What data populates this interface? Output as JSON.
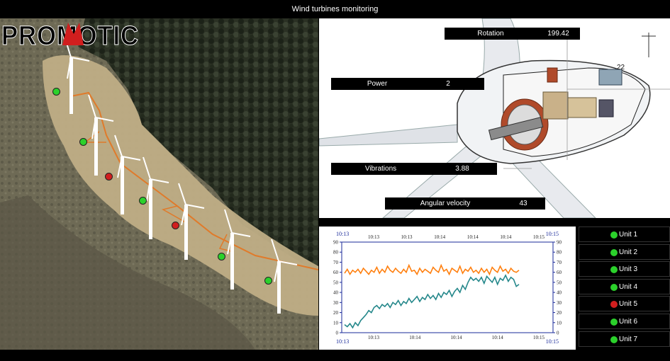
{
  "app": {
    "title": "Wind turbines monitoring"
  },
  "logo": {
    "text": "PROMOTIC"
  },
  "readouts": {
    "rotation": {
      "label": "Rotation",
      "value": "199.42"
    },
    "power": {
      "label": "Power",
      "value": "2"
    },
    "vibrations": {
      "label": "Vibrations",
      "value": "3.88"
    },
    "angular_velocity": {
      "label": "Angular velocity",
      "value": "43"
    },
    "wind_label": "22"
  },
  "colors": {
    "ok": "#2bd12b",
    "fault": "#d11e1e",
    "orange": "#ff7f0e",
    "teal": "#24878a",
    "axis": "#1a2a9a"
  },
  "map_markers": [
    {
      "status": "ok"
    },
    {
      "status": "ok"
    },
    {
      "status": "fault"
    },
    {
      "status": "ok"
    },
    {
      "status": "fault"
    },
    {
      "status": "ok"
    },
    {
      "status": "ok"
    }
  ],
  "units": [
    {
      "name": "Unit 1",
      "status": "ok"
    },
    {
      "name": "Unit 2",
      "status": "ok"
    },
    {
      "name": "Unit 3",
      "status": "ok"
    },
    {
      "name": "Unit 4",
      "status": "ok"
    },
    {
      "name": "Unit 5",
      "status": "fault"
    },
    {
      "name": "Unit 6",
      "status": "ok"
    },
    {
      "name": "Unit 7",
      "status": "ok"
    }
  ],
  "chart_data": {
    "type": "line",
    "ylim": [
      0,
      90
    ],
    "y_ticks": [
      "0",
      "10",
      "20",
      "30",
      "40",
      "50",
      "60",
      "70",
      "80",
      "90"
    ],
    "top_left_time": "10:13",
    "top_right_time": "10:15",
    "bottom_left_time": "10:13",
    "bottom_right_time": "10:15",
    "x_ticks_top": [
      "10:13",
      "10:13",
      "10:14",
      "10:14",
      "10:14",
      "10:15"
    ],
    "x_ticks_bottom": [
      "10:13",
      "10:14",
      "10:14",
      "10:14",
      "10:15"
    ],
    "grid": true,
    "series": [
      {
        "color": "#ff7f0e",
        "values": [
          59,
          63,
          58,
          62,
          60,
          63,
          59,
          64,
          61,
          58,
          62,
          60,
          65,
          59,
          63,
          60,
          66,
          62,
          60,
          64,
          61,
          59,
          63,
          60,
          67,
          61,
          62,
          58,
          64,
          60,
          63,
          61,
          59,
          65,
          62,
          60,
          67,
          61,
          63,
          58,
          64,
          62,
          60,
          66,
          59,
          63,
          61,
          65,
          60,
          62,
          59,
          64,
          60,
          63,
          58,
          65,
          62,
          60,
          66,
          61,
          63,
          59,
          64,
          61,
          60,
          62
        ]
      },
      {
        "color": "#24878a",
        "values": [
          8,
          6,
          9,
          5,
          10,
          7,
          12,
          15,
          18,
          22,
          20,
          25,
          27,
          24,
          28,
          26,
          29,
          25,
          30,
          28,
          32,
          27,
          31,
          29,
          34,
          30,
          33,
          36,
          31,
          35,
          33,
          38,
          34,
          37,
          33,
          39,
          35,
          40,
          38,
          42,
          36,
          41,
          44,
          40,
          47,
          43,
          50,
          55,
          52,
          54,
          51,
          55,
          49,
          56,
          53,
          50,
          55,
          48,
          54,
          52,
          57,
          51,
          55,
          53,
          46,
          48
        ]
      }
    ]
  }
}
